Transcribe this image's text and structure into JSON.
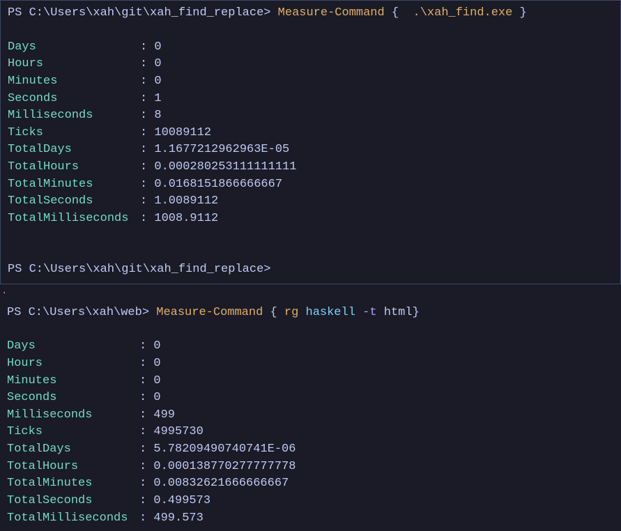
{
  "pane1": {
    "prompt_ps": "PS ",
    "prompt_path": "C:\\Users\\xah\\git\\xah_find_replace> ",
    "cmdlet": "Measure-Command",
    "brace_open": " {  ",
    "executable": ".\\xah_find.exe",
    "brace_close": " }",
    "rows": [
      {
        "name": "Days",
        "value": "0"
      },
      {
        "name": "Hours",
        "value": "0"
      },
      {
        "name": "Minutes",
        "value": "0"
      },
      {
        "name": "Seconds",
        "value": "1"
      },
      {
        "name": "Milliseconds",
        "value": "8"
      },
      {
        "name": "Ticks",
        "value": "10089112"
      },
      {
        "name": "TotalDays",
        "value": "1.1677212962963E-05"
      },
      {
        "name": "TotalHours",
        "value": "0.000280253111111111"
      },
      {
        "name": "TotalMinutes",
        "value": "0.0168151866666667"
      },
      {
        "name": "TotalSeconds",
        "value": "1.0089112"
      },
      {
        "name": "TotalMilliseconds",
        "value": "1008.9112"
      }
    ],
    "prompt2_path": "C:\\Users\\xah\\git\\xah_find_replace>"
  },
  "artifact": ".",
  "pane2": {
    "prompt_ps": "PS ",
    "prompt_path": "C:\\Users\\xah\\web> ",
    "cmdlet": "Measure-Command",
    "brace_open": " { ",
    "cmd": "rg",
    "arg1": " haskell ",
    "flag": "-t",
    "arg2": " html",
    "brace_close": "}",
    "rows": [
      {
        "name": "Days",
        "value": "0"
      },
      {
        "name": "Hours",
        "value": "0"
      },
      {
        "name": "Minutes",
        "value": "0"
      },
      {
        "name": "Seconds",
        "value": "0"
      },
      {
        "name": "Milliseconds",
        "value": "499"
      },
      {
        "name": "Ticks",
        "value": "4995730"
      },
      {
        "name": "TotalDays",
        "value": "5.78209490740741E-06"
      },
      {
        "name": "TotalHours",
        "value": "0.000138770277777778"
      },
      {
        "name": "TotalMinutes",
        "value": "0.00832621666666667"
      },
      {
        "name": "TotalSeconds",
        "value": "0.499573"
      },
      {
        "name": "TotalMilliseconds",
        "value": "499.573"
      }
    ]
  }
}
